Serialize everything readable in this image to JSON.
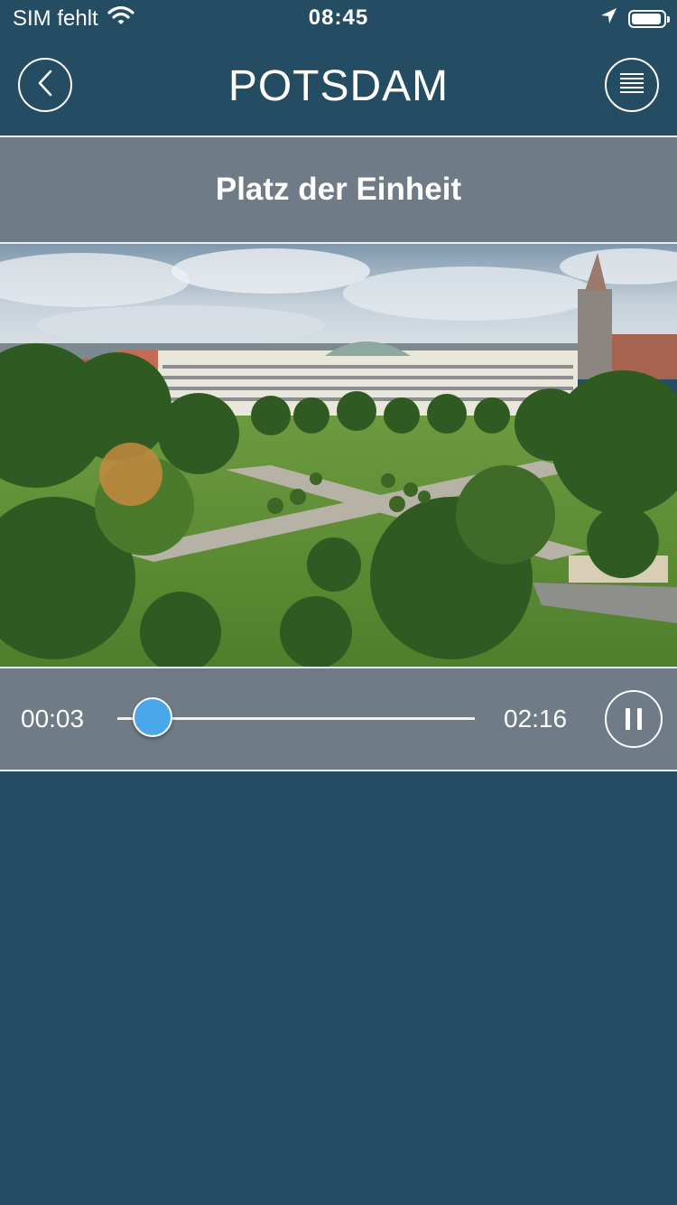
{
  "status_bar": {
    "carrier": "SIM fehlt",
    "time": "08:45",
    "icons": [
      "wifi-icon",
      "location-arrow-icon",
      "battery-icon"
    ]
  },
  "nav": {
    "title": "POTSDAM",
    "back_icon": "chevron-left-icon",
    "menu_icon": "menu-lines-icon"
  },
  "station": {
    "title": "Platz der Einheit"
  },
  "player": {
    "current_time": "00:03",
    "total_time": "02:16",
    "progress_fraction": 0.022,
    "state": "playing",
    "control_icon": "pause-icon"
  },
  "colors": {
    "background": "#244c63",
    "bar": "#6f7b86",
    "accent": "#4aa8ea"
  }
}
